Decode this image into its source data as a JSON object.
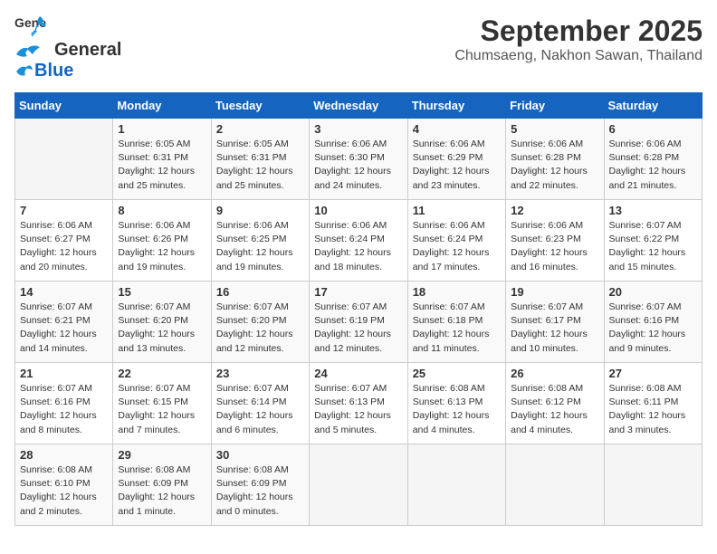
{
  "header": {
    "logo": {
      "line1": "General",
      "line2": "Blue"
    },
    "title": "September 2025",
    "subtitle": "Chumsaeng, Nakhon Sawan, Thailand"
  },
  "calendar": {
    "weekdays": [
      "Sunday",
      "Monday",
      "Tuesday",
      "Wednesday",
      "Thursday",
      "Friday",
      "Saturday"
    ],
    "weeks": [
      [
        {
          "day": "",
          "info": ""
        },
        {
          "day": "1",
          "info": "Sunrise: 6:05 AM\nSunset: 6:31 PM\nDaylight: 12 hours\nand 25 minutes."
        },
        {
          "day": "2",
          "info": "Sunrise: 6:05 AM\nSunset: 6:31 PM\nDaylight: 12 hours\nand 25 minutes."
        },
        {
          "day": "3",
          "info": "Sunrise: 6:06 AM\nSunset: 6:30 PM\nDaylight: 12 hours\nand 24 minutes."
        },
        {
          "day": "4",
          "info": "Sunrise: 6:06 AM\nSunset: 6:29 PM\nDaylight: 12 hours\nand 23 minutes."
        },
        {
          "day": "5",
          "info": "Sunrise: 6:06 AM\nSunset: 6:28 PM\nDaylight: 12 hours\nand 22 minutes."
        },
        {
          "day": "6",
          "info": "Sunrise: 6:06 AM\nSunset: 6:28 PM\nDaylight: 12 hours\nand 21 minutes."
        }
      ],
      [
        {
          "day": "7",
          "info": "Sunrise: 6:06 AM\nSunset: 6:27 PM\nDaylight: 12 hours\nand 20 minutes."
        },
        {
          "day": "8",
          "info": "Sunrise: 6:06 AM\nSunset: 6:26 PM\nDaylight: 12 hours\nand 19 minutes."
        },
        {
          "day": "9",
          "info": "Sunrise: 6:06 AM\nSunset: 6:25 PM\nDaylight: 12 hours\nand 19 minutes."
        },
        {
          "day": "10",
          "info": "Sunrise: 6:06 AM\nSunset: 6:24 PM\nDaylight: 12 hours\nand 18 minutes."
        },
        {
          "day": "11",
          "info": "Sunrise: 6:06 AM\nSunset: 6:24 PM\nDaylight: 12 hours\nand 17 minutes."
        },
        {
          "day": "12",
          "info": "Sunrise: 6:06 AM\nSunset: 6:23 PM\nDaylight: 12 hours\nand 16 minutes."
        },
        {
          "day": "13",
          "info": "Sunrise: 6:07 AM\nSunset: 6:22 PM\nDaylight: 12 hours\nand 15 minutes."
        }
      ],
      [
        {
          "day": "14",
          "info": "Sunrise: 6:07 AM\nSunset: 6:21 PM\nDaylight: 12 hours\nand 14 minutes."
        },
        {
          "day": "15",
          "info": "Sunrise: 6:07 AM\nSunset: 6:20 PM\nDaylight: 12 hours\nand 13 minutes."
        },
        {
          "day": "16",
          "info": "Sunrise: 6:07 AM\nSunset: 6:20 PM\nDaylight: 12 hours\nand 12 minutes."
        },
        {
          "day": "17",
          "info": "Sunrise: 6:07 AM\nSunset: 6:19 PM\nDaylight: 12 hours\nand 12 minutes."
        },
        {
          "day": "18",
          "info": "Sunrise: 6:07 AM\nSunset: 6:18 PM\nDaylight: 12 hours\nand 11 minutes."
        },
        {
          "day": "19",
          "info": "Sunrise: 6:07 AM\nSunset: 6:17 PM\nDaylight: 12 hours\nand 10 minutes."
        },
        {
          "day": "20",
          "info": "Sunrise: 6:07 AM\nSunset: 6:16 PM\nDaylight: 12 hours\nand 9 minutes."
        }
      ],
      [
        {
          "day": "21",
          "info": "Sunrise: 6:07 AM\nSunset: 6:16 PM\nDaylight: 12 hours\nand 8 minutes."
        },
        {
          "day": "22",
          "info": "Sunrise: 6:07 AM\nSunset: 6:15 PM\nDaylight: 12 hours\nand 7 minutes."
        },
        {
          "day": "23",
          "info": "Sunrise: 6:07 AM\nSunset: 6:14 PM\nDaylight: 12 hours\nand 6 minutes."
        },
        {
          "day": "24",
          "info": "Sunrise: 6:07 AM\nSunset: 6:13 PM\nDaylight: 12 hours\nand 5 minutes."
        },
        {
          "day": "25",
          "info": "Sunrise: 6:08 AM\nSunset: 6:13 PM\nDaylight: 12 hours\nand 4 minutes."
        },
        {
          "day": "26",
          "info": "Sunrise: 6:08 AM\nSunset: 6:12 PM\nDaylight: 12 hours\nand 4 minutes."
        },
        {
          "day": "27",
          "info": "Sunrise: 6:08 AM\nSunset: 6:11 PM\nDaylight: 12 hours\nand 3 minutes."
        }
      ],
      [
        {
          "day": "28",
          "info": "Sunrise: 6:08 AM\nSunset: 6:10 PM\nDaylight: 12 hours\nand 2 minutes."
        },
        {
          "day": "29",
          "info": "Sunrise: 6:08 AM\nSunset: 6:09 PM\nDaylight: 12 hours\nand 1 minute."
        },
        {
          "day": "30",
          "info": "Sunrise: 6:08 AM\nSunset: 6:09 PM\nDaylight: 12 hours\nand 0 minutes."
        },
        {
          "day": "",
          "info": ""
        },
        {
          "day": "",
          "info": ""
        },
        {
          "day": "",
          "info": ""
        },
        {
          "day": "",
          "info": ""
        }
      ]
    ]
  }
}
